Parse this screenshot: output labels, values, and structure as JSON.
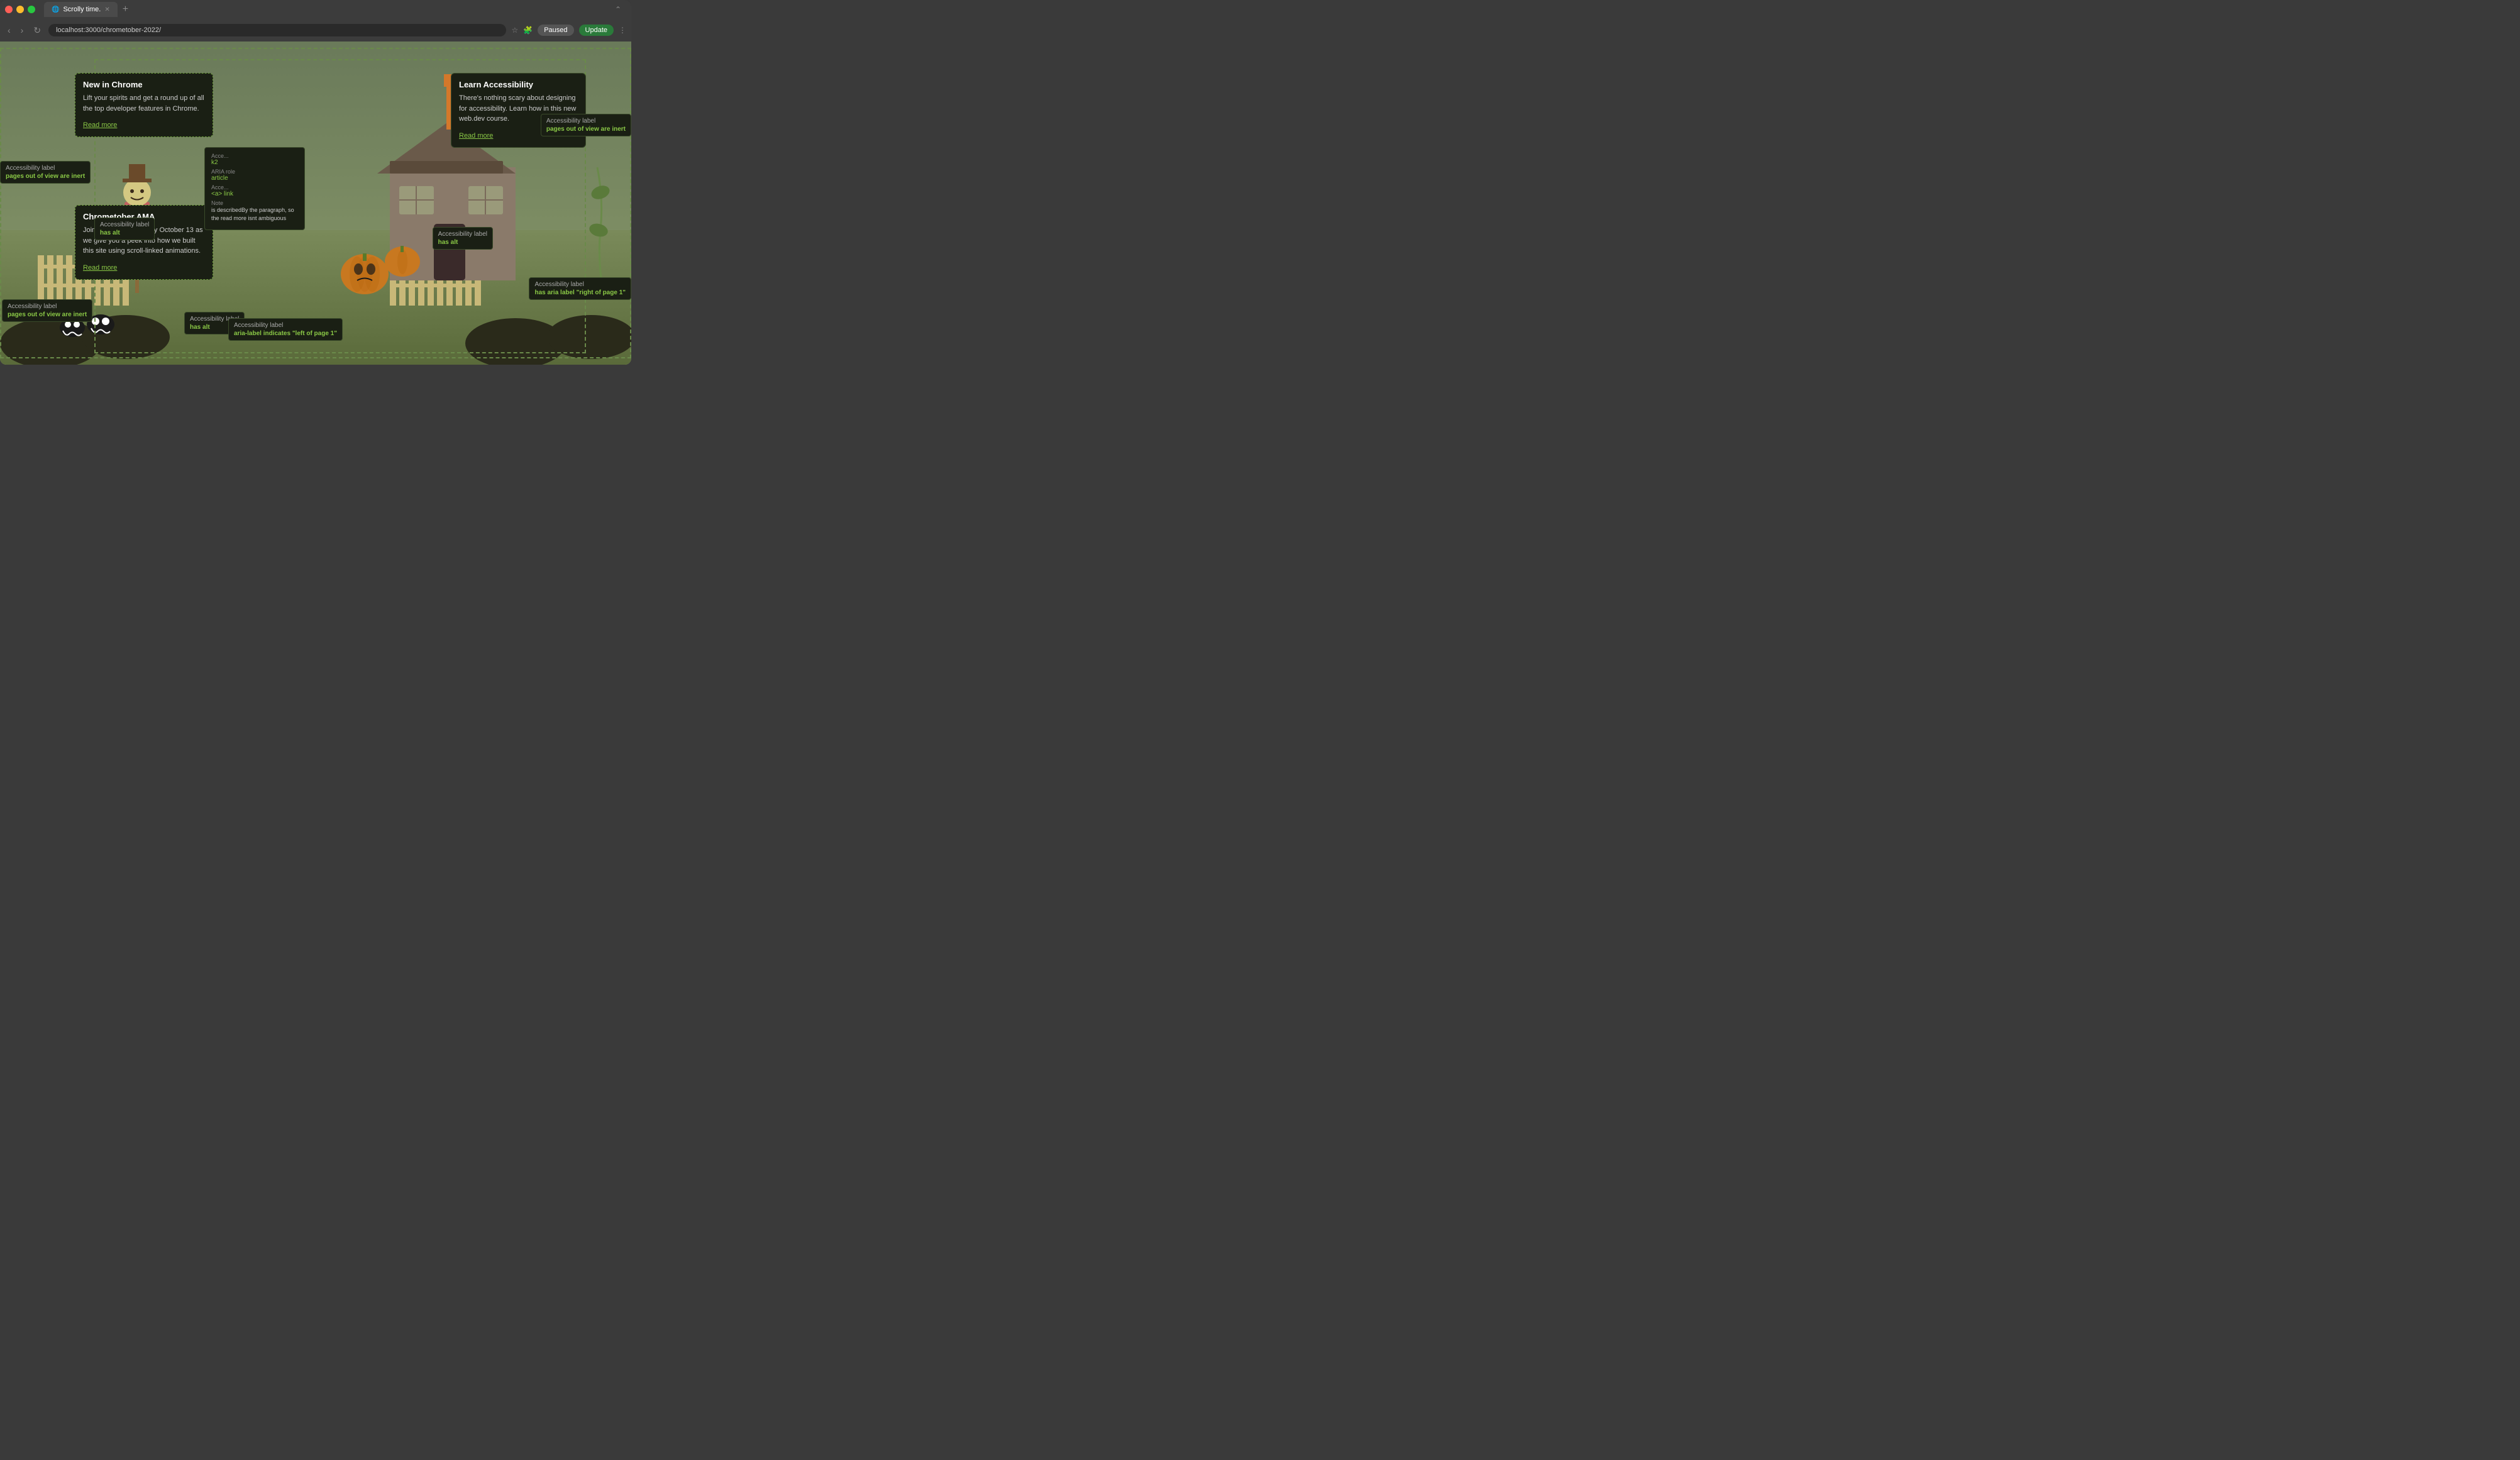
{
  "browser": {
    "tab_title": "Scrolly time.",
    "url": "localhost:3000/chrometober-2022/",
    "paused_label": "Paused",
    "update_label": "Update",
    "new_tab_icon": "+"
  },
  "cards": {
    "new_in_chrome": {
      "title": "New in Chrome",
      "body": "Lift your spirits and get a round up of all the top developer features in Chrome.",
      "read_more": "Read more"
    },
    "learn_accessibility": {
      "title": "Learn Accessibility",
      "body": "There's nothing scary about designing for accessibility. Learn how in this new web.dev course.",
      "read_more": "Read more"
    },
    "chrometober_ama": {
      "title": "Chrometober AMA",
      "body": "Join us live on Thursday October 13 as we give you a peek into how we built this site using scroll-linked animations.",
      "read_more": "Read more"
    }
  },
  "accessibility_labels": {
    "label1": {
      "title": "Accessibility label",
      "value": "pages out of view are inert"
    },
    "label2": {
      "title": "Accessibility label",
      "value": "has alt"
    },
    "label3": {
      "title": "Accessibility label",
      "value": "has alt"
    },
    "label4": {
      "title": "Accessibility label",
      "value": "pages out of view are inert"
    },
    "label5": {
      "title": "Accessibility label",
      "value": "has alt"
    },
    "label6": {
      "title": "Accessibility label",
      "value": "aria-label indicates \"left of page 1\""
    },
    "label7": {
      "title": "Accessibility label",
      "value": "has aria label \"right of page 1\""
    }
  },
  "aria_popup": {
    "acc_name_label": "Acce...",
    "acc_name_value": "k2",
    "acc_name2_label": "Acce...",
    "acc_name2_value": "<a> link",
    "aria_role_label": "ARIA role",
    "aria_role_value": "article",
    "note_label": "Note",
    "note_text": "is describedBy the paragraph, so the read more isnt ambiguous"
  },
  "colors": {
    "accent_green": "#8ac846",
    "dark_bg": "#1a1f14",
    "scene_bg": "#7a8a5a",
    "fence_color": "#c8b878",
    "house_wall": "#8a7a6a",
    "pumpkin_orange": "#d4782a",
    "black": "#1a1a1a"
  }
}
